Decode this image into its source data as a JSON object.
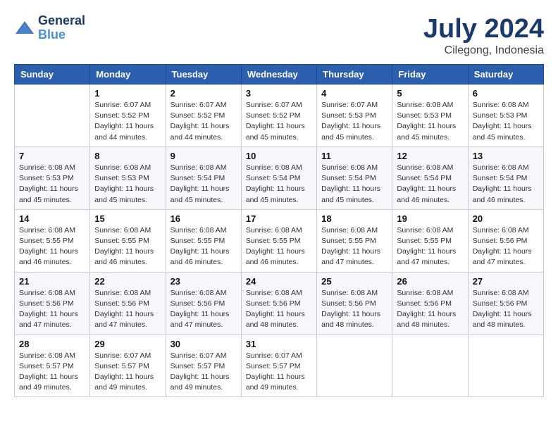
{
  "header": {
    "logo_line1": "General",
    "logo_line2": "Blue",
    "month": "July 2024",
    "location": "Cilegong, Indonesia"
  },
  "days_of_week": [
    "Sunday",
    "Monday",
    "Tuesday",
    "Wednesday",
    "Thursday",
    "Friday",
    "Saturday"
  ],
  "weeks": [
    [
      {
        "day": "",
        "info": ""
      },
      {
        "day": "1",
        "info": "Sunrise: 6:07 AM\nSunset: 5:52 PM\nDaylight: 11 hours\nand 44 minutes."
      },
      {
        "day": "2",
        "info": "Sunrise: 6:07 AM\nSunset: 5:52 PM\nDaylight: 11 hours\nand 44 minutes."
      },
      {
        "day": "3",
        "info": "Sunrise: 6:07 AM\nSunset: 5:52 PM\nDaylight: 11 hours\nand 45 minutes."
      },
      {
        "day": "4",
        "info": "Sunrise: 6:07 AM\nSunset: 5:53 PM\nDaylight: 11 hours\nand 45 minutes."
      },
      {
        "day": "5",
        "info": "Sunrise: 6:08 AM\nSunset: 5:53 PM\nDaylight: 11 hours\nand 45 minutes."
      },
      {
        "day": "6",
        "info": "Sunrise: 6:08 AM\nSunset: 5:53 PM\nDaylight: 11 hours\nand 45 minutes."
      }
    ],
    [
      {
        "day": "7",
        "info": "Sunrise: 6:08 AM\nSunset: 5:53 PM\nDaylight: 11 hours\nand 45 minutes."
      },
      {
        "day": "8",
        "info": "Sunrise: 6:08 AM\nSunset: 5:53 PM\nDaylight: 11 hours\nand 45 minutes."
      },
      {
        "day": "9",
        "info": "Sunrise: 6:08 AM\nSunset: 5:54 PM\nDaylight: 11 hours\nand 45 minutes."
      },
      {
        "day": "10",
        "info": "Sunrise: 6:08 AM\nSunset: 5:54 PM\nDaylight: 11 hours\nand 45 minutes."
      },
      {
        "day": "11",
        "info": "Sunrise: 6:08 AM\nSunset: 5:54 PM\nDaylight: 11 hours\nand 45 minutes."
      },
      {
        "day": "12",
        "info": "Sunrise: 6:08 AM\nSunset: 5:54 PM\nDaylight: 11 hours\nand 46 minutes."
      },
      {
        "day": "13",
        "info": "Sunrise: 6:08 AM\nSunset: 5:54 PM\nDaylight: 11 hours\nand 46 minutes."
      }
    ],
    [
      {
        "day": "14",
        "info": "Sunrise: 6:08 AM\nSunset: 5:55 PM\nDaylight: 11 hours\nand 46 minutes."
      },
      {
        "day": "15",
        "info": "Sunrise: 6:08 AM\nSunset: 5:55 PM\nDaylight: 11 hours\nand 46 minutes."
      },
      {
        "day": "16",
        "info": "Sunrise: 6:08 AM\nSunset: 5:55 PM\nDaylight: 11 hours\nand 46 minutes."
      },
      {
        "day": "17",
        "info": "Sunrise: 6:08 AM\nSunset: 5:55 PM\nDaylight: 11 hours\nand 46 minutes."
      },
      {
        "day": "18",
        "info": "Sunrise: 6:08 AM\nSunset: 5:55 PM\nDaylight: 11 hours\nand 47 minutes."
      },
      {
        "day": "19",
        "info": "Sunrise: 6:08 AM\nSunset: 5:55 PM\nDaylight: 11 hours\nand 47 minutes."
      },
      {
        "day": "20",
        "info": "Sunrise: 6:08 AM\nSunset: 5:56 PM\nDaylight: 11 hours\nand 47 minutes."
      }
    ],
    [
      {
        "day": "21",
        "info": "Sunrise: 6:08 AM\nSunset: 5:56 PM\nDaylight: 11 hours\nand 47 minutes."
      },
      {
        "day": "22",
        "info": "Sunrise: 6:08 AM\nSunset: 5:56 PM\nDaylight: 11 hours\nand 47 minutes."
      },
      {
        "day": "23",
        "info": "Sunrise: 6:08 AM\nSunset: 5:56 PM\nDaylight: 11 hours\nand 47 minutes."
      },
      {
        "day": "24",
        "info": "Sunrise: 6:08 AM\nSunset: 5:56 PM\nDaylight: 11 hours\nand 48 minutes."
      },
      {
        "day": "25",
        "info": "Sunrise: 6:08 AM\nSunset: 5:56 PM\nDaylight: 11 hours\nand 48 minutes."
      },
      {
        "day": "26",
        "info": "Sunrise: 6:08 AM\nSunset: 5:56 PM\nDaylight: 11 hours\nand 48 minutes."
      },
      {
        "day": "27",
        "info": "Sunrise: 6:08 AM\nSunset: 5:56 PM\nDaylight: 11 hours\nand 48 minutes."
      }
    ],
    [
      {
        "day": "28",
        "info": "Sunrise: 6:08 AM\nSunset: 5:57 PM\nDaylight: 11 hours\nand 49 minutes."
      },
      {
        "day": "29",
        "info": "Sunrise: 6:07 AM\nSunset: 5:57 PM\nDaylight: 11 hours\nand 49 minutes."
      },
      {
        "day": "30",
        "info": "Sunrise: 6:07 AM\nSunset: 5:57 PM\nDaylight: 11 hours\nand 49 minutes."
      },
      {
        "day": "31",
        "info": "Sunrise: 6:07 AM\nSunset: 5:57 PM\nDaylight: 11 hours\nand 49 minutes."
      },
      {
        "day": "",
        "info": ""
      },
      {
        "day": "",
        "info": ""
      },
      {
        "day": "",
        "info": ""
      }
    ]
  ]
}
